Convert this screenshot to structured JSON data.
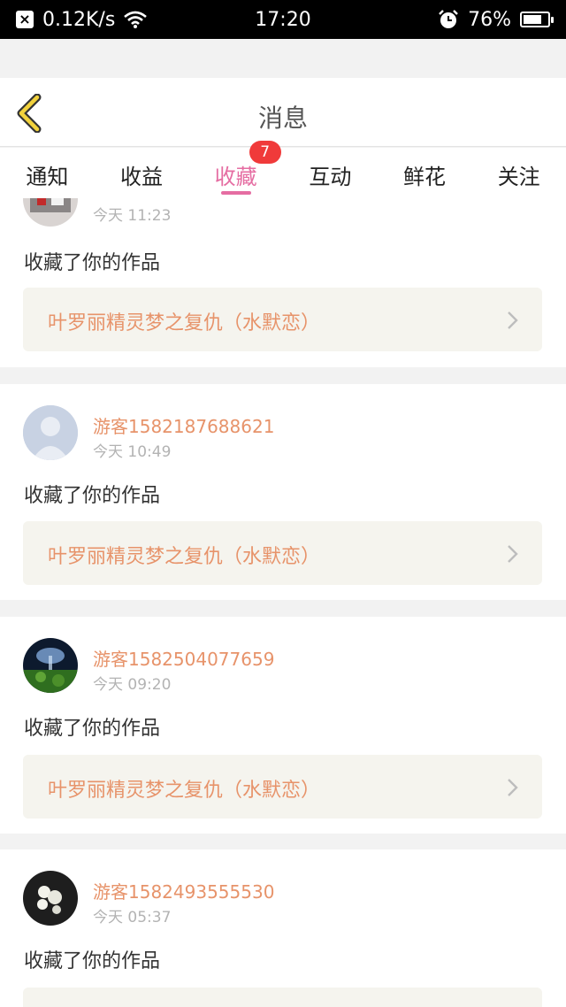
{
  "status_bar": {
    "speed": "0.12K/s",
    "time": "17:20",
    "battery": "76%",
    "battery_level": 0.76,
    "icons": [
      "notification-x-icon",
      "wifi-icon",
      "alarm-icon",
      "battery-icon"
    ]
  },
  "header": {
    "title": "消息",
    "back_icon": "chevron-left-icon"
  },
  "tabs": [
    {
      "label": "通知"
    },
    {
      "label": "收益"
    },
    {
      "label": "收藏",
      "active": true,
      "badge": "7"
    },
    {
      "label": "互动"
    },
    {
      "label": "鲜花"
    },
    {
      "label": "关注"
    }
  ],
  "colors": {
    "accent_pink": "#e56da2",
    "badge_red": "#f03a3a",
    "name_orange": "#e7936a",
    "work_box_bg": "#f5f4ee",
    "time_gray": "#b3b3b3"
  },
  "messages": [
    {
      "name": "",
      "time": "今天 11:23",
      "action": "收藏了你的作品",
      "work": "叶罗丽精灵梦之复仇（水默恋）",
      "avatar": "avatar-photo"
    },
    {
      "name": "游客1582187688621",
      "time": "今天 10:49",
      "action": "收藏了你的作品",
      "work": "叶罗丽精灵梦之复仇（水默恋）",
      "avatar": "avatar-default"
    },
    {
      "name": "游客1582504077659",
      "time": "今天 09:20",
      "action": "收藏了你的作品",
      "work": "叶罗丽精灵梦之复仇（水默恋）",
      "avatar": "avatar-photo"
    },
    {
      "name": "游客1582493555530",
      "time": "今天 05:37",
      "action": "收藏了你的作品",
      "work": "",
      "avatar": "avatar-photo"
    }
  ]
}
